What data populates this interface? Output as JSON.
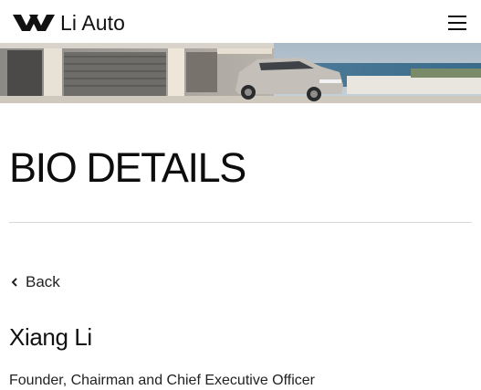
{
  "header": {
    "brand_name": "Li Auto",
    "logo_icon": "li-auto-logo-icon",
    "menu_icon": "hamburger-menu-icon"
  },
  "hero": {
    "image": "banner-image"
  },
  "page": {
    "title": "BIO DETAILS"
  },
  "nav": {
    "back_label": "Back",
    "back_icon": "chevron-left-icon"
  },
  "bio": {
    "name": "Xiang Li",
    "role": "Founder, Chairman and Chief Executive Officer"
  },
  "colors": {
    "text": "#111111",
    "divider": "#d8d8d8",
    "background": "#ffffff"
  }
}
